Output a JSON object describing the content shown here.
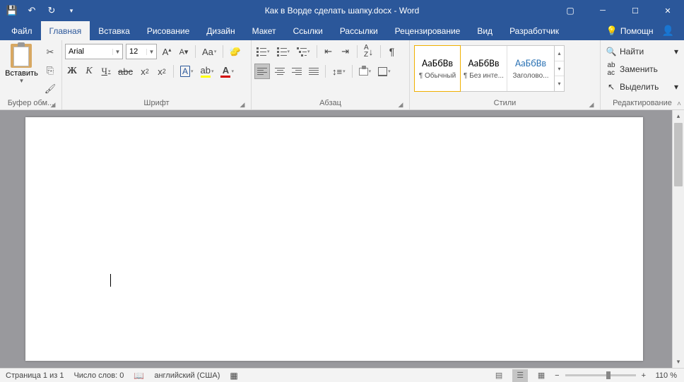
{
  "title": "Как в Ворде сделать шапку.docx  -  Word",
  "tabs": {
    "file": "Файл",
    "home": "Главная",
    "insert": "Вставка",
    "draw": "Рисование",
    "design": "Дизайн",
    "layout": "Макет",
    "references": "Ссылки",
    "mailings": "Рассылки",
    "review": "Рецензирование",
    "view": "Вид",
    "developer": "Разработчик",
    "tellme": "Помощн"
  },
  "ribbon": {
    "clipboard": {
      "paste": "Вставить",
      "label": "Буфер обм..."
    },
    "font": {
      "name": "Arial",
      "size": "12",
      "label": "Шрифт",
      "caseBtn": "Aa",
      "textA": "A"
    },
    "paragraph": {
      "label": "Абзац"
    },
    "styles": {
      "label": "Стили",
      "preview": "АаБбВв",
      "s1": "¶ Обычный",
      "s2": "¶ Без инте...",
      "s3": "Заголово..."
    },
    "editing": {
      "label": "Редактирование",
      "find": "Найти",
      "replace": "Заменить",
      "select": "Выделить"
    }
  },
  "status": {
    "page": "Страница 1 из 1",
    "words": "Число слов: 0",
    "lang": "английский (США)",
    "zoom": "110 %",
    "minus": "−",
    "plus": "+"
  }
}
